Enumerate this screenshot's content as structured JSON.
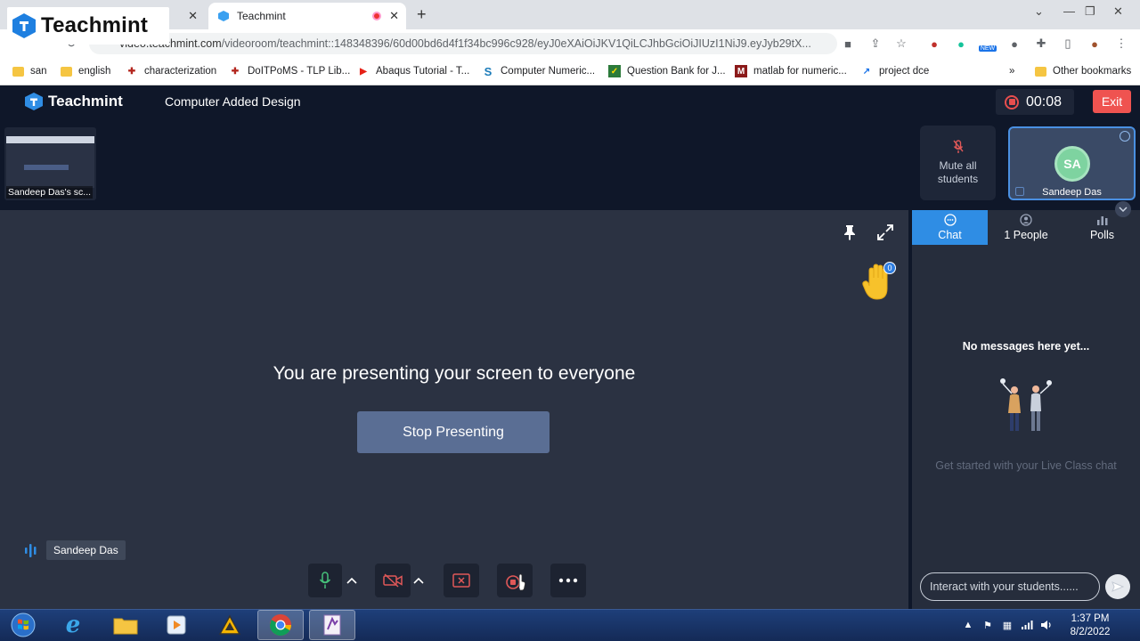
{
  "browser": {
    "tabs": [
      {
        "label": "Teachmint",
        "active": true
      }
    ],
    "url_host": "video.teachmint.com",
    "url_path": "/videoroom/teachmint::148348396/60d00bd6d4f1f34bc996c928/eyJ0eXAiOiJKV1QiLCJhbGciOiJIUzI1NiJ9.eyJyb29tX...",
    "bookmarks": [
      {
        "label": "san",
        "icon": "folder-icon"
      },
      {
        "label": "english",
        "icon": "folder-icon"
      },
      {
        "label": "characterization",
        "icon": "cambridge-icon"
      },
      {
        "label": "DoITPoMS - TLP Lib...",
        "icon": "cambridge-icon"
      },
      {
        "label": "Abaqus Tutorial - T...",
        "icon": "youtube-icon"
      },
      {
        "label": "Computer Numeric...",
        "icon": "scribd-icon"
      },
      {
        "label": "Question Bank for J...",
        "icon": "check-icon"
      },
      {
        "label": "matlab for numeric...",
        "icon": "book-icon"
      },
      {
        "label": "project dce",
        "icon": "link-icon"
      }
    ],
    "other_bookmarks": "Other bookmarks",
    "overflow": "»",
    "extension_badge": "NEW"
  },
  "logo_overlay": "Teachmint",
  "header": {
    "brand": "Teachmint",
    "class_title": "Computer Added Design",
    "timer": "00:08",
    "exit_label": "Exit"
  },
  "strip": {
    "screen_share_caption": "Sandeep Das's sc...",
    "mute_all_line1": "Mute all",
    "mute_all_line2": "students",
    "self_initials": "SA",
    "self_name": "Sandeep Das"
  },
  "stage": {
    "message": "You are presenting your screen to everyone",
    "stop_label": "Stop Presenting",
    "speaker_name": "Sandeep Das",
    "raised_hands": "0"
  },
  "sidebar": {
    "tabs": [
      {
        "label": "Chat",
        "icon": "chat-icon"
      },
      {
        "label": "1 People",
        "icon": "people-icon"
      },
      {
        "label": "Polls",
        "icon": "polls-icon"
      }
    ],
    "empty_title": "No messages here yet...",
    "empty_sub": "Get started with your Live Class chat",
    "input_placeholder": "Interact with your students......"
  },
  "taskbar": {
    "time": "1:37 PM",
    "date": "8/2/2022"
  },
  "colors": {
    "accent": "#2f8de4",
    "exit": "#ef5350",
    "stage": "#2b3242",
    "header": "#0f1729"
  }
}
